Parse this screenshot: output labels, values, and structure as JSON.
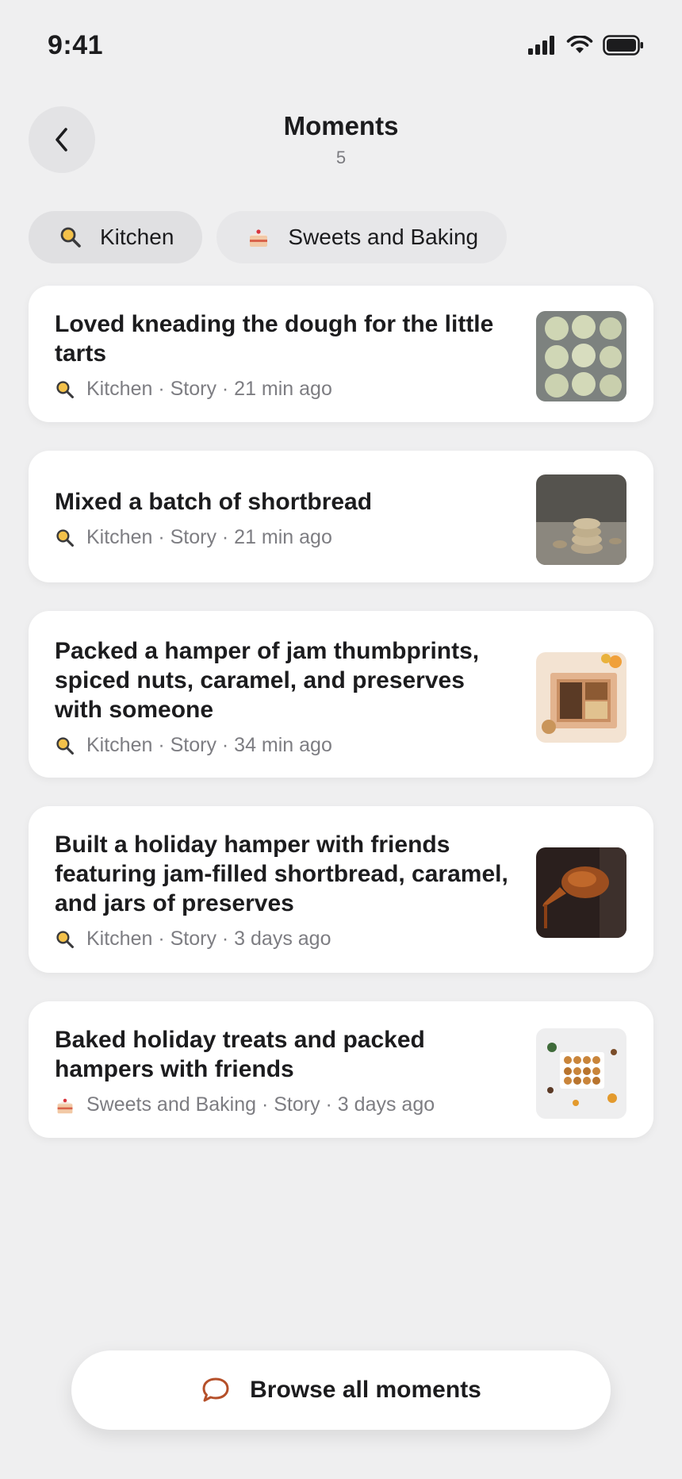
{
  "status": {
    "time": "9:41"
  },
  "header": {
    "title": "Moments",
    "count": "5"
  },
  "chips": [
    {
      "label": "Kitchen",
      "icon": "magnifier-emoji-icon"
    },
    {
      "label": "Sweets and Baking",
      "icon": "cake-icon"
    }
  ],
  "cards": [
    {
      "title": "Loved kneading the dough for the little tarts",
      "category": "Kitchen",
      "type": "Story",
      "time": "21 min ago",
      "meta": "Kitchen · Story · 21 min ago",
      "thumb": "dough-balls-photo"
    },
    {
      "title": "Mixed a batch of shortbread",
      "category": "Kitchen",
      "type": "Story",
      "time": "21 min ago",
      "meta": "Kitchen · Story · 21 min ago",
      "thumb": "shortbread-stack-photo"
    },
    {
      "title": "Packed a hamper of jam thumbprints, spiced nuts, caramel, and preserves with someone",
      "category": "Kitchen",
      "type": "Story",
      "time": "34 min ago",
      "meta": "Kitchen · Story · 34 min ago",
      "thumb": "hamper-box-photo"
    },
    {
      "title": "Built a holiday hamper with friends featuring jam-filled shortbread, caramel, and jars of preserves",
      "category": "Kitchen",
      "type": "Story",
      "time": "3 days ago",
      "meta": "Kitchen · Story · 3 days ago",
      "thumb": "caramel-drip-photo"
    },
    {
      "title": "Baked holiday treats and packed hampers with friends",
      "category": "Sweets and Baking",
      "type": "Story",
      "time": "3 days ago",
      "meta": "Sweets and Baking · Story · 3 days ago",
      "thumb": "holiday-treats-photo"
    }
  ],
  "browse_button": {
    "label": "Browse all moments"
  },
  "colors": {
    "background": "#efeff0",
    "accent": "#b5502a",
    "meta_text": "#7d7d82"
  }
}
